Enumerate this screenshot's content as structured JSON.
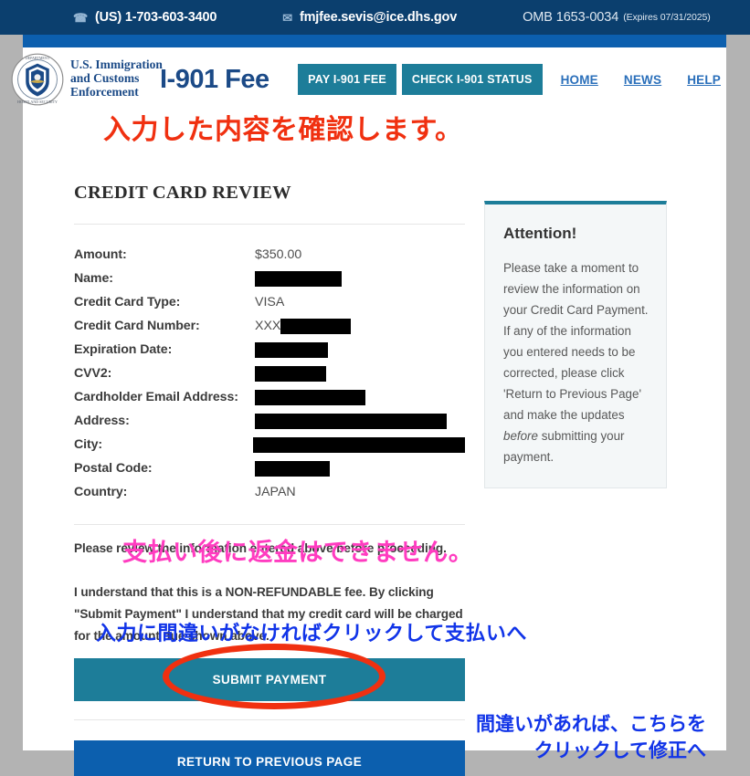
{
  "topbar": {
    "phone_icon": "phone-icon",
    "phone": "(US) 1-703-603-3400",
    "mail_icon": "envelope-icon",
    "email": "fmjfee.sevis@ice.dhs.gov",
    "omb_number": "OMB 1653-0034",
    "omb_expires": "(Expires 07/31/2025)"
  },
  "header": {
    "agency_line1": "U.S. Immigration",
    "agency_line2": "and Customs",
    "agency_line3": "Enforcement",
    "brand": "I-901 Fee",
    "nav_buttons": [
      {
        "label": "PAY I-901 FEE"
      },
      {
        "label": "CHECK I-901 STATUS"
      }
    ],
    "nav_links": [
      {
        "label": "HOME"
      },
      {
        "label": "NEWS"
      },
      {
        "label": "HELP"
      }
    ]
  },
  "main": {
    "title": "CREDIT CARD REVIEW",
    "fields": [
      {
        "label": "Amount:",
        "value": "$350.00",
        "redacted": false,
        "redact_width": 0,
        "prefix": ""
      },
      {
        "label": "Name:",
        "value": "",
        "redacted": true,
        "redact_width": 95,
        "prefix": ""
      },
      {
        "label": "Credit Card Type:",
        "value": "VISA",
        "redacted": false,
        "redact_width": 0,
        "prefix": ""
      },
      {
        "label": "Credit Card Number:",
        "value": "",
        "redacted": true,
        "redact_width": 77,
        "prefix": "XXX"
      },
      {
        "label": "Expiration Date:",
        "value": "",
        "redacted": true,
        "redact_width": 80,
        "prefix": ""
      },
      {
        "label": "CVV2:",
        "value": "",
        "redacted": true,
        "redact_width": 78,
        "prefix": ""
      },
      {
        "label": "Cardholder Email Address:",
        "value": "",
        "redacted": true,
        "redact_width": 121,
        "prefix": ""
      },
      {
        "label": "Address:",
        "value": "",
        "redacted": true,
        "redact_width": 210,
        "prefix": ""
      },
      {
        "label": "City:",
        "value": "",
        "redacted": true,
        "redact_width": 232,
        "prefix": ""
      },
      {
        "label": "Postal Code:",
        "value": "",
        "redacted": true,
        "redact_width": 82,
        "prefix": ""
      },
      {
        "label": "Country:",
        "value": "JAPAN",
        "redacted": false,
        "redact_width": 0,
        "prefix": ""
      }
    ],
    "notice_line1": "Please review the information entered above before proceeding.",
    "notice_line2": "I understand that this is a NON-REFUNDABLE fee. By clicking \"Submit Payment\" I understand that my credit card will be charged for the amount due shown above.",
    "submit_label": "SUBMIT PAYMENT",
    "return_label": "RETURN TO PREVIOUS PAGE"
  },
  "aside": {
    "heading": "Attention!",
    "body_before": "Please take a moment to review the information on your Credit Card Payment. If any of the information you entered needs to be corrected, please click 'Return to Previous Page' and make the updates ",
    "body_emphasis": "before",
    "body_after": " submitting your payment."
  },
  "annotations": {
    "red_title": "入力した内容を確認します。",
    "pink_warning": "支払い後に返金はできません。",
    "blue_submit": "入力に間違いがなければクリックして支払いへ",
    "blue_return": "間違いがあれば、こちらを\nクリックして修正へ"
  },
  "colors": {
    "navy": "#0b3f6e",
    "blue_strip": "#0c5fae",
    "teal_button": "#1d7d99",
    "blue_button": "#0c5fae",
    "link_blue": "#2a6fba",
    "annotation_red": "#f03010",
    "annotation_pink": "#ff3cc0",
    "annotation_blue": "#1134e8",
    "page_background": "#b3b3b3"
  }
}
